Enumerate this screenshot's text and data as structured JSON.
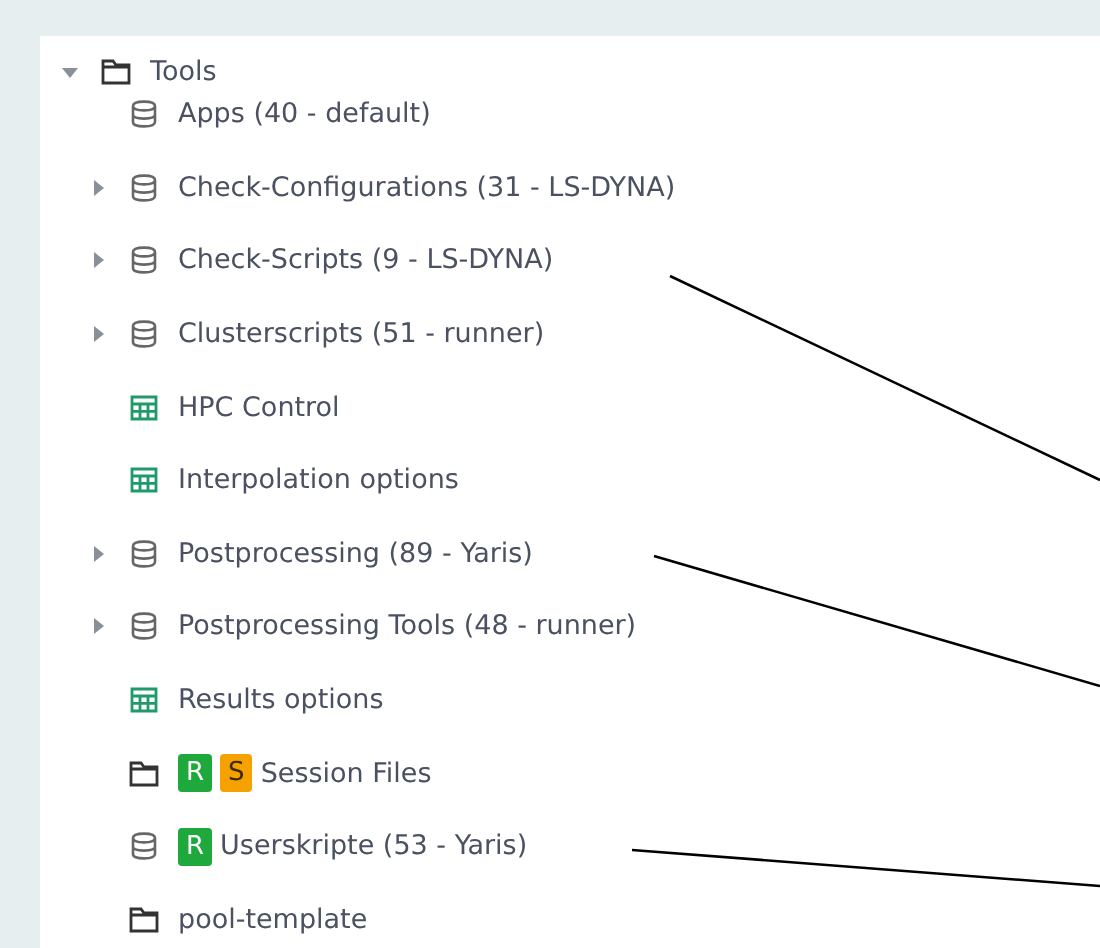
{
  "tree": {
    "label": "Tools",
    "kind": "folder",
    "expanded": true,
    "children": [
      {
        "label": "Apps (40 - default)",
        "kind": "database"
      },
      {
        "label": "Check-Configurations (31 - LS-DYNA)",
        "kind": "database",
        "expanded": false
      },
      {
        "label": "Check-Scripts (9 - LS-DYNA)",
        "kind": "database",
        "expanded": false
      },
      {
        "label": "Clusterscripts (51 - runner)",
        "kind": "database",
        "expanded": false
      },
      {
        "label": "HPC Control",
        "kind": "table"
      },
      {
        "label": "Interpolation options",
        "kind": "table"
      },
      {
        "label": "Postprocessing (89 - Yaris)",
        "kind": "database",
        "expanded": false
      },
      {
        "label": "Postprocessing Tools (48 - runner)",
        "kind": "database",
        "expanded": false
      },
      {
        "label": "Results options",
        "kind": "table"
      },
      {
        "label": "Session Files",
        "kind": "folder",
        "badges": [
          {
            "text": "R",
            "color": "#1fa83c"
          },
          {
            "text": "S",
            "color": "#f5a200"
          }
        ]
      },
      {
        "label": "Userskripte (53 - Yaris)",
        "kind": "database",
        "badges": [
          {
            "text": "R",
            "color": "#1fa83c"
          }
        ]
      },
      {
        "label": "pool-template",
        "kind": "folder"
      }
    ]
  }
}
